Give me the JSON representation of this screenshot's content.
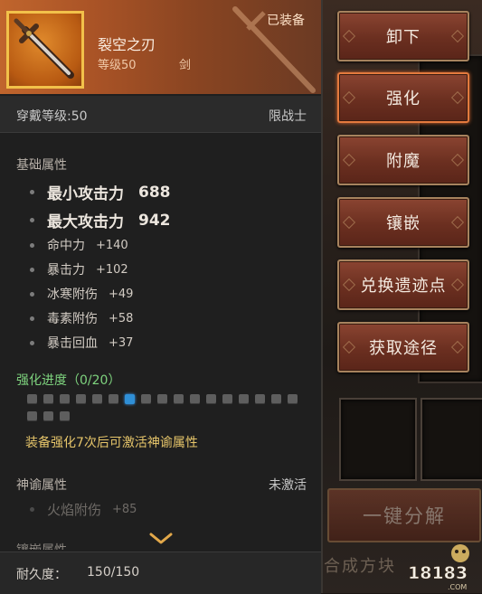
{
  "item": {
    "name": "裂空之刃",
    "level_label": "等级50",
    "type": "剑",
    "equipped": "已装备",
    "wear_level": "穿戴等级:50",
    "class_limit": "限战士"
  },
  "basic": {
    "title": "基础属性",
    "main": [
      {
        "name": "最小攻击力",
        "value": "688"
      },
      {
        "name": "最大攻击力",
        "value": "942"
      }
    ],
    "sub": [
      {
        "name": "命中力",
        "value": "+140"
      },
      {
        "name": "暴击力",
        "value": "+102"
      },
      {
        "name": "冰寒附伤",
        "value": "+49"
      },
      {
        "name": "毒素附伤",
        "value": "+58"
      },
      {
        "name": "暴击回血",
        "value": "+37"
      }
    ]
  },
  "enhance": {
    "title": "强化进度（0/20）",
    "total_pips": 20,
    "highlighted_pip": 7,
    "note": "装备强化7次后可激活神谕属性"
  },
  "divine": {
    "title": "神谕属性",
    "status": "未激活",
    "attr_name": "火焰附伤",
    "attr_value": "+85"
  },
  "cut_off_text": "镶嵌属性",
  "durability": {
    "label": "耐久度：",
    "value": "150/150"
  },
  "buttons": [
    "卸下",
    "强化",
    "附魔",
    "镶嵌",
    "兑换遗迹点",
    "获取途径"
  ],
  "active_button": 1,
  "background": {
    "decompose_button": "一键分解",
    "bottom_text": "合成方块",
    "logo": "18183.COM"
  },
  "colors": {
    "header_orange": "#c0652d",
    "button_red": "#7a3a28",
    "enhance_green": "#7ed37e",
    "note_gold": "#e6c56a",
    "pip_active": "#2f8fd6"
  }
}
